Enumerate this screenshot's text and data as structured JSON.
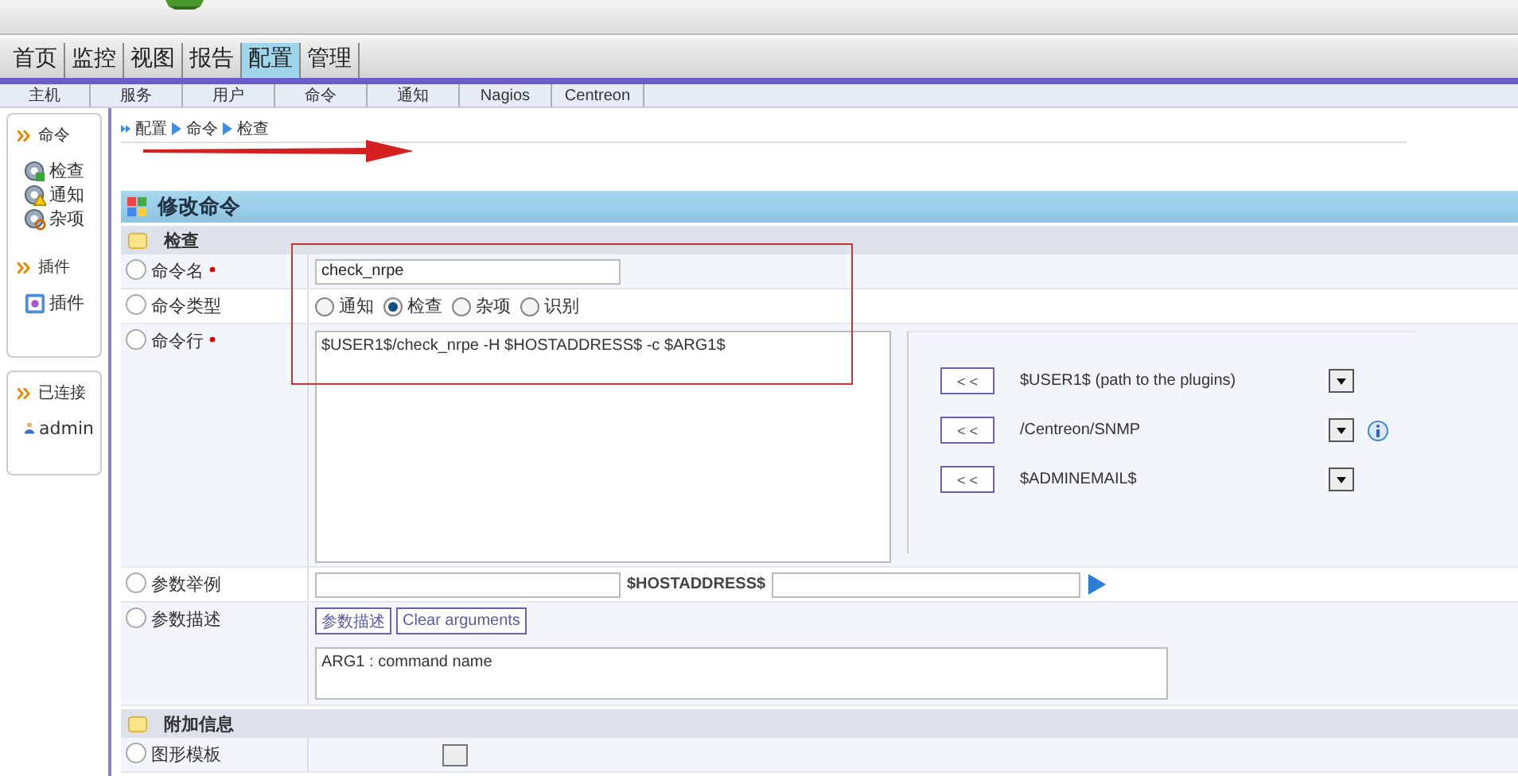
{
  "top_menu": [
    {
      "label": "首页",
      "selected": false
    },
    {
      "label": "监控",
      "selected": false
    },
    {
      "label": "视图",
      "selected": false
    },
    {
      "label": "报告",
      "selected": false
    },
    {
      "label": "配置",
      "selected": true
    },
    {
      "label": "管理",
      "selected": false
    }
  ],
  "sub_menu": [
    "主机",
    "服务",
    "用户",
    "命令",
    "通知",
    "Nagios",
    "Centreon"
  ],
  "sidebar": [
    {
      "title": "命令",
      "items": [
        {
          "label": "检查",
          "kind": "gear"
        },
        {
          "label": "通知",
          "kind": "alert"
        },
        {
          "label": "杂项",
          "kind": "search"
        }
      ]
    },
    {
      "title": "插件",
      "items": [
        {
          "label": "插件",
          "kind": "plugin"
        }
      ]
    },
    {
      "title": "已连接",
      "items": [
        {
          "label": "admin",
          "kind": "user"
        }
      ]
    }
  ],
  "breadcrumb": [
    "配置",
    "命令",
    "检查"
  ],
  "form": {
    "title": "修改命令",
    "sections": [
      {
        "title": "检查",
        "rows": [
          {
            "kind": "text",
            "label": "命令名",
            "required": true,
            "value": "check_nrpe"
          },
          {
            "kind": "radio",
            "label": "命令类型",
            "required": false,
            "options": [
              {
                "label": "通知",
                "selected": false
              },
              {
                "label": "检查",
                "selected": true
              },
              {
                "label": "杂项",
                "selected": false
              },
              {
                "label": "识别",
                "selected": false
              }
            ]
          },
          {
            "kind": "commandline",
            "label": "命令行",
            "required": true,
            "value": "$USER1$/check_nrpe -H $HOSTADDRESS$ -c $ARG1$",
            "macros": [
              {
                "button": "< <",
                "value": "$USER1$ (path to the plugins)",
                "info": false
              },
              {
                "button": "< <",
                "value": "/Centreon/SNMP",
                "info": true
              },
              {
                "button": "< <",
                "value": "$ADMINEMAIL$",
                "info": false
              }
            ]
          },
          {
            "kind": "example",
            "label": "参数举例",
            "required": false,
            "macro": "$HOSTADDRESS$"
          },
          {
            "kind": "description",
            "label": "参数描述",
            "required": false,
            "buttons": [
              "参数描述",
              "Clear arguments"
            ],
            "value": "ARG1 : command name"
          }
        ]
      },
      {
        "title": "附加信息",
        "rows": [
          {
            "kind": "select",
            "label": "图形模板",
            "required": false
          }
        ]
      }
    ]
  }
}
